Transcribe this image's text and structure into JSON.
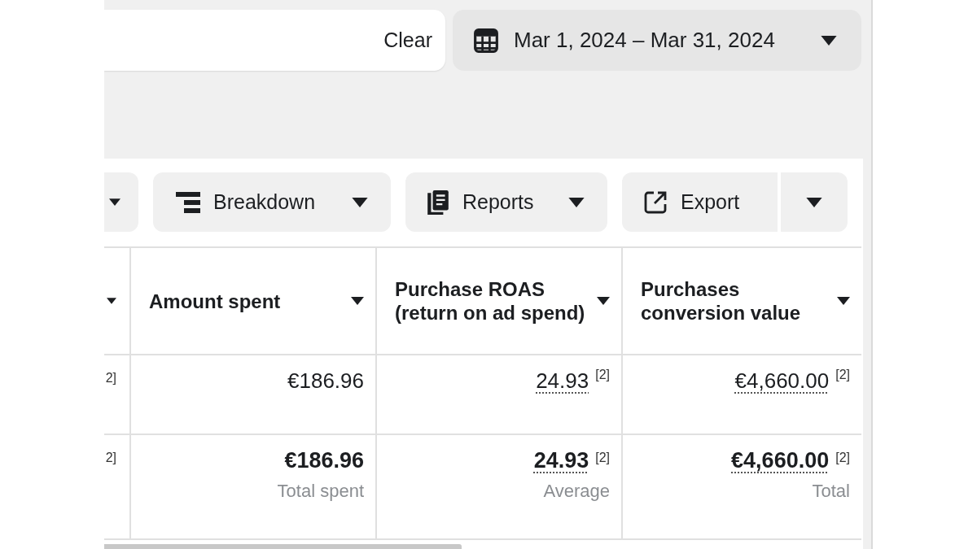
{
  "search": {
    "clear_label": "Clear"
  },
  "date_range": {
    "label": "Mar 1, 2024 – Mar 31, 2024"
  },
  "toolbar": [
    {
      "kind": "caret"
    },
    {
      "kind": "dropdown",
      "label": "Breakdown"
    },
    {
      "kind": "dropdown",
      "label": "Reports"
    },
    {
      "kind": "split",
      "label": "Export"
    }
  ],
  "table": {
    "columns": [
      {
        "kind": "cut"
      },
      {
        "kind": "sortable",
        "label": "Amount spent"
      },
      {
        "kind": "sortable",
        "label": "Purchase ROAS (return on ad spend)"
      },
      {
        "kind": "sortable",
        "label": "Purchases conversion value"
      }
    ],
    "rows": [
      {
        "kind": "result",
        "cells": [
          {
            "note": "2]"
          },
          {
            "value": "€186.96",
            "underlined": false
          },
          {
            "value": "24.93",
            "note": "[2]",
            "underlined": true
          },
          {
            "value": "€4,660.00",
            "note": "[2]",
            "underlined": true
          }
        ]
      },
      {
        "kind": "summary",
        "cells": [
          {
            "note": "2]"
          },
          {
            "value": "€186.96",
            "caption": "Total spent",
            "underlined": false
          },
          {
            "value": "24.93",
            "note": "[2]",
            "caption": "Average",
            "underlined": true
          },
          {
            "value": "€4,660.00",
            "note": "[2]",
            "caption": "Total",
            "underlined": true
          }
        ]
      }
    ]
  }
}
